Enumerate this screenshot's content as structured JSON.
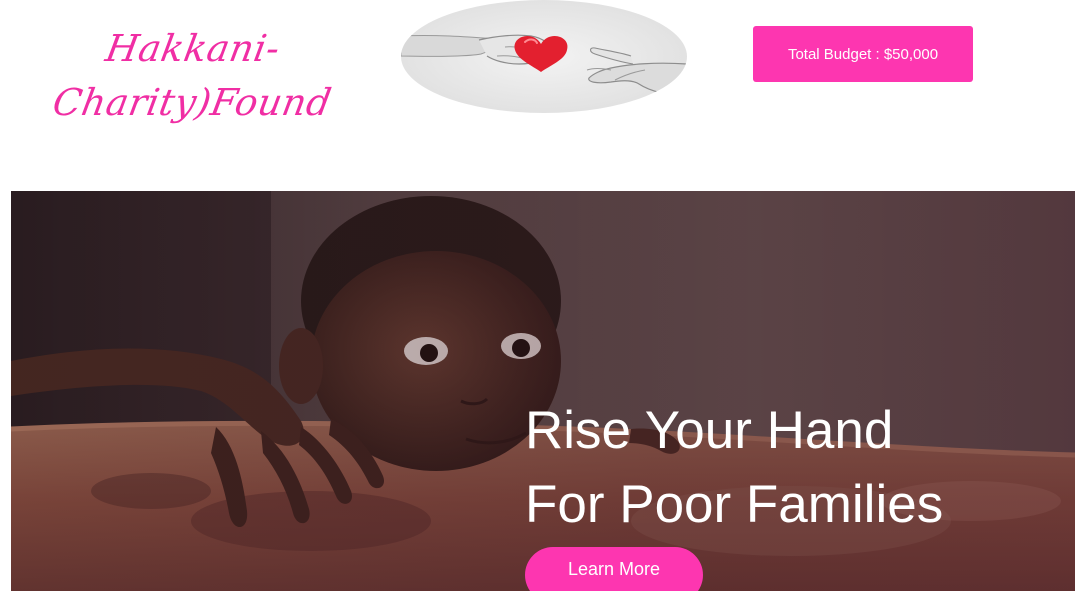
{
  "header": {
    "logo_line1": "Hakkani-",
    "logo_line2": "Charity)Found",
    "budget_label": "Total Budget : $50,000"
  },
  "hero": {
    "title_line1": "Rise Your Hand",
    "title_line2": "For Poor Families",
    "cta_label": "Learn More"
  },
  "colors": {
    "brand_pink": "#fd36b0",
    "logo_pink": "#f02ea4",
    "heart_red": "#e3202f"
  },
  "icons": {
    "heart": "heart-icon"
  }
}
